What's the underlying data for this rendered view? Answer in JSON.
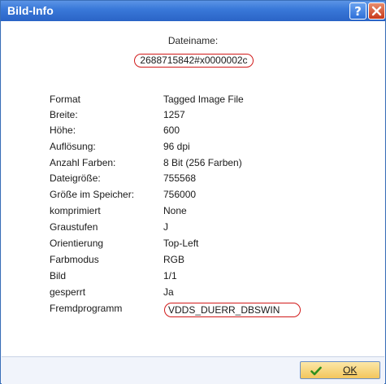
{
  "window": {
    "title": "Bild-Info",
    "help_label": "?"
  },
  "filename": {
    "label": "Dateiname:",
    "value": "2688715842#x0000002c"
  },
  "info": [
    {
      "key": "Format",
      "value": "Tagged Image File"
    },
    {
      "key": "Breite:",
      "value": "1257"
    },
    {
      "key": "Höhe:",
      "value": "600"
    },
    {
      "key": "Auflösung:",
      "value": "96 dpi"
    },
    {
      "key": "Anzahl Farben:",
      "value": "8 Bit (256 Farben)"
    },
    {
      "key": "Dateigröße:",
      "value": "755568"
    },
    {
      "key": "Größe im Speicher:",
      "value": "756000"
    },
    {
      "key": "komprimiert",
      "value": "None"
    },
    {
      "key": "Graustufen",
      "value": "J"
    },
    {
      "key": "Orientierung",
      "value": "Top-Left"
    },
    {
      "key": "Farbmodus",
      "value": "RGB"
    },
    {
      "key": "Bild",
      "value": "1/1"
    },
    {
      "key": "gesperrt",
      "value": "Ja"
    },
    {
      "key": "Fremdprogramm",
      "value": "VDDS_DUERR_DBSWIN"
    }
  ],
  "footer": {
    "ok_label": "OK"
  },
  "colors": {
    "titlebar": "#2a64c6",
    "annotation": "#d11a1a",
    "ok_button": "#f3c65c",
    "check": "#2f8f1f"
  },
  "icons": {
    "help": "help-icon",
    "close": "close-icon",
    "ok": "checkmark-icon"
  }
}
